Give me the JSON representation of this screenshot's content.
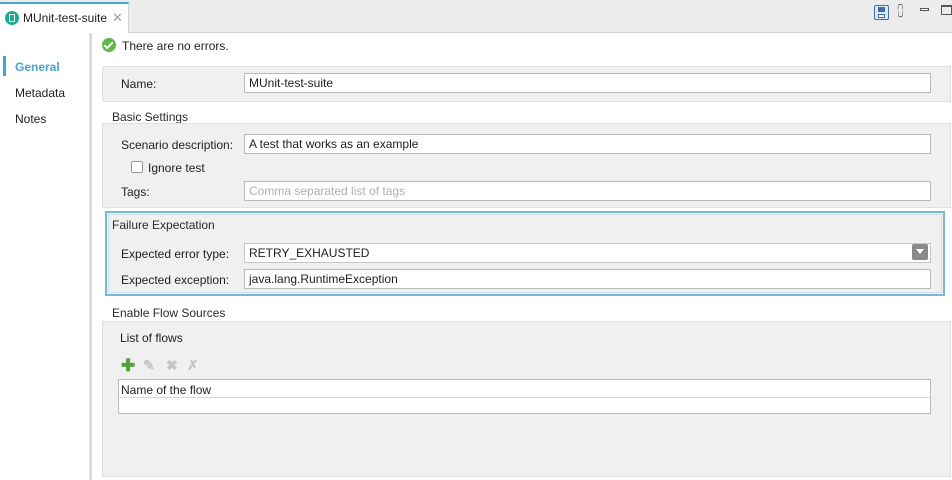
{
  "tab": {
    "title": "MUnit-test-suite",
    "close_glyph": "✕"
  },
  "toolbar": {
    "icons": [
      "save-icon",
      "tree-icon",
      "minimize-icon",
      "maximize-icon"
    ],
    "tree_glyph": "⩇"
  },
  "nav": {
    "items": [
      {
        "label": "General",
        "active": true
      },
      {
        "label": "Metadata"
      },
      {
        "label": "Notes"
      }
    ]
  },
  "status": {
    "text": "There are no errors."
  },
  "general": {
    "name_label": "Name:",
    "name_value": "MUnit-test-suite"
  },
  "basic_settings": {
    "title": "Basic Settings",
    "description_label": "Scenario description:",
    "description_value": "A test that works as an example",
    "ignore_label": "Ignore test",
    "ignore_checked": false,
    "tags_label": "Tags:",
    "tags_placeholder": "Comma separated list of tags"
  },
  "failure": {
    "title": "Failure Expectation",
    "error_type_label": "Expected error type:",
    "error_type_value": "RETRY_EXHAUSTED",
    "exception_label": "Expected exception:",
    "exception_value": "java.lang.RuntimeException"
  },
  "flow_sources": {
    "title": "Enable Flow Sources",
    "list_label": "List of flows",
    "column_header": "Name of the flow",
    "add_glyph": "✚",
    "edit_glyph": "✎",
    "delete_glyph": "✖",
    "clear_glyph": "✗"
  },
  "colors": {
    "accent": "#4aa3c8",
    "success": "#5eb84a",
    "add": "#4ba434"
  }
}
